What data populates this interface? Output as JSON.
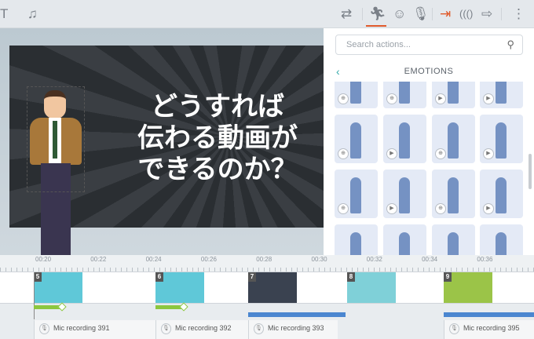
{
  "toolbar": {
    "left_tools": [
      "text-icon",
      "music-icon"
    ],
    "right_tools": [
      "swap-icon",
      "actions-icon",
      "emotions-icon",
      "mic-icon",
      "enter-icon",
      "effects-icon",
      "exit-icon",
      "more-icon"
    ],
    "active_tool": "actions-icon",
    "accent": "#e05a2b"
  },
  "slide": {
    "headline": [
      "どうすれば",
      "伝わる動画が",
      "できるのか？"
    ]
  },
  "panel": {
    "search_placeholder": "Search actions...",
    "category": "EMOTIONS",
    "tiles": [
      "zoom",
      "zoom",
      "play",
      "play",
      "zoom",
      "play",
      "zoom",
      "play",
      "zoom",
      "play",
      "zoom",
      "play",
      "none",
      "none",
      "none",
      "none"
    ]
  },
  "timeline": {
    "ticks": [
      "00:20",
      "00:22",
      "00:24",
      "00:26",
      "00:28",
      "00:30",
      "00:32",
      "00:34",
      "00:36"
    ],
    "scenes": [
      {
        "num": "5",
        "color": "#5fc8d8"
      },
      {
        "num": "6",
        "color": "#5fc8d8"
      },
      {
        "num": "7",
        "color": "#3a4250"
      },
      {
        "num": "8",
        "color": "#7fd0d8"
      },
      {
        "num": "9",
        "color": "#9bc448"
      }
    ],
    "mics": [
      "Mic recording 391",
      "Mic recording 392",
      "Mic recording 393",
      "Mic recording 395"
    ]
  }
}
